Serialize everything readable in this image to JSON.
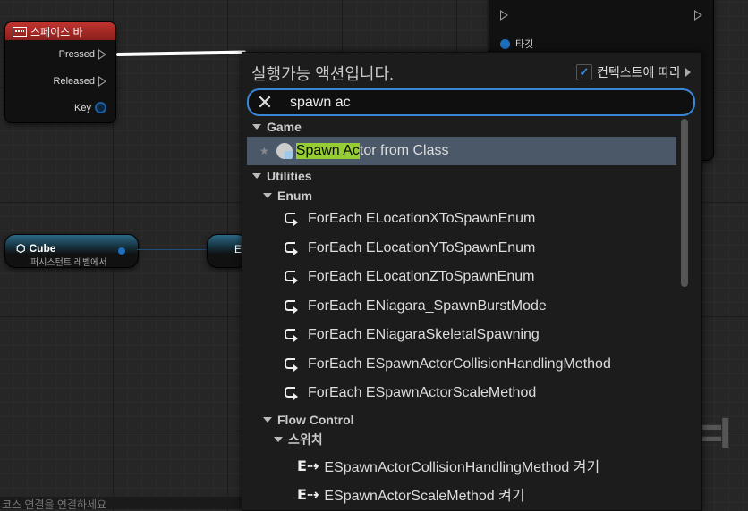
{
  "graph": {
    "spacebar_node": {
      "title": "스페이스 바",
      "pins": [
        "Pressed",
        "Released",
        "Key"
      ]
    },
    "target_node": {
      "pin_label": "타깃"
    },
    "cube_node": {
      "title": "Cube",
      "subtitle": "퍼시스턴트 레벨에서"
    },
    "b_node": {
      "label": "E"
    },
    "bg_text": "=I",
    "status": "코스 연결을 연결하세요"
  },
  "menu": {
    "title": "실행가능 액션입니다.",
    "context_toggle": {
      "label": "컨텍스트에 따라",
      "checked": true
    },
    "search": {
      "value": "spawn ac"
    },
    "tree": {
      "cat_game": "Game",
      "spawn_actor": {
        "highlight": "Spawn Ac",
        "rest": "tor from Class"
      },
      "cat_utilities": "Utilities",
      "cat_enum": "Enum",
      "enum_items": [
        "ForEach ELocationXToSpawnEnum",
        "ForEach ELocationYToSpawnEnum",
        "ForEach ELocationZToSpawnEnum",
        "ForEach ENiagara_SpawnBurstMode",
        "ForEach ENiagaraSkeletalSpawning",
        "ForEach ESpawnActorCollisionHandlingMethod",
        "ForEach ESpawnActorScaleMethod"
      ],
      "cat_flow": "Flow Control",
      "cat_switch": "스위치",
      "switch_items": [
        "ESpawnActorCollisionHandlingMethod 켜기",
        "ESpawnActorScaleMethod 켜기"
      ]
    }
  },
  "colors": {
    "accent": "#3a86d6",
    "highlight": "#96cd33",
    "selected_row": "#4a5868",
    "event_header": "#c0342f"
  }
}
